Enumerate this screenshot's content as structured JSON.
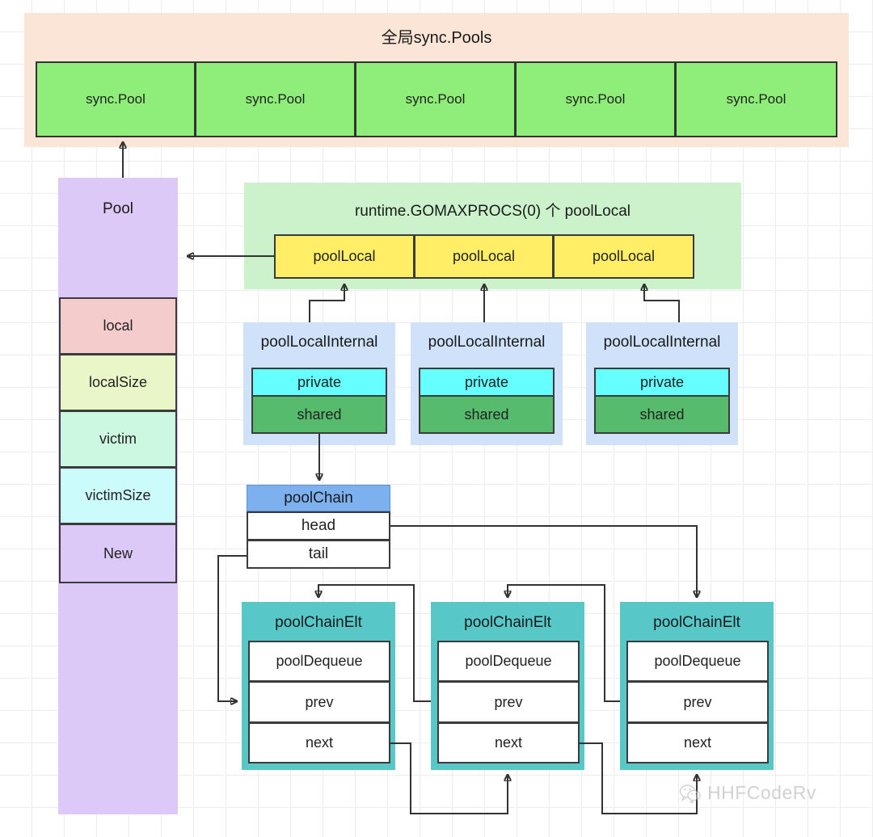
{
  "global_pools": {
    "title": "全局sync.Pools",
    "items": [
      {
        "label": "sync.Pool"
      },
      {
        "label": "sync.Pool"
      },
      {
        "label": "sync.Pool"
      },
      {
        "label": "sync.Pool"
      },
      {
        "label": "sync.Pool"
      }
    ],
    "background_color": "#fbe5d6",
    "item_color": "#8eee79"
  },
  "pool": {
    "title": "Pool",
    "background_color": "#ddc9f7",
    "fields": [
      {
        "label": "local",
        "color": "#f4cccc"
      },
      {
        "label": "localSize",
        "color": "#e9f7c8"
      },
      {
        "label": "victim",
        "color": "#ccf7e0"
      },
      {
        "label": "victimSize",
        "color": "#ccfbfb"
      },
      {
        "label": "New",
        "color": "#ddc9f7"
      }
    ]
  },
  "pool_locals": {
    "title": "runtime.GOMAXPROCS(0) 个 poolLocal",
    "background_color": "#ccf2cc",
    "item_color": "#ffee66",
    "items": [
      {
        "label": "poolLocal"
      },
      {
        "label": "poolLocal"
      },
      {
        "label": "poolLocal"
      }
    ]
  },
  "pool_local_internals": [
    {
      "title": "poolLocalInternal",
      "private": "private",
      "shared": "shared"
    },
    {
      "title": "poolLocalInternal",
      "private": "private",
      "shared": "shared"
    },
    {
      "title": "poolLocalInternal",
      "private": "private",
      "shared": "shared"
    }
  ],
  "internal_colors": {
    "wrapper": "#cfe2f9",
    "private": "#66ffff",
    "shared": "#57bb6e"
  },
  "pool_chain": {
    "title": "poolChain",
    "header_color": "#7cb0ef",
    "rows": [
      {
        "label": "head"
      },
      {
        "label": "tail"
      }
    ]
  },
  "pool_chain_elts": [
    {
      "title": "poolChainElt",
      "rows": [
        {
          "label": "poolDequeue"
        },
        {
          "label": "prev"
        },
        {
          "label": "next"
        }
      ]
    },
    {
      "title": "poolChainElt",
      "rows": [
        {
          "label": "poolDequeue"
        },
        {
          "label": "prev"
        },
        {
          "label": "next"
        }
      ]
    },
    {
      "title": "poolChainElt",
      "rows": [
        {
          "label": "poolDequeue"
        },
        {
          "label": "prev"
        },
        {
          "label": "next"
        }
      ]
    }
  ],
  "elt_color": "#57c7c7",
  "watermark": {
    "icon": "wechat-icon",
    "text": "HHFCodeRv"
  }
}
